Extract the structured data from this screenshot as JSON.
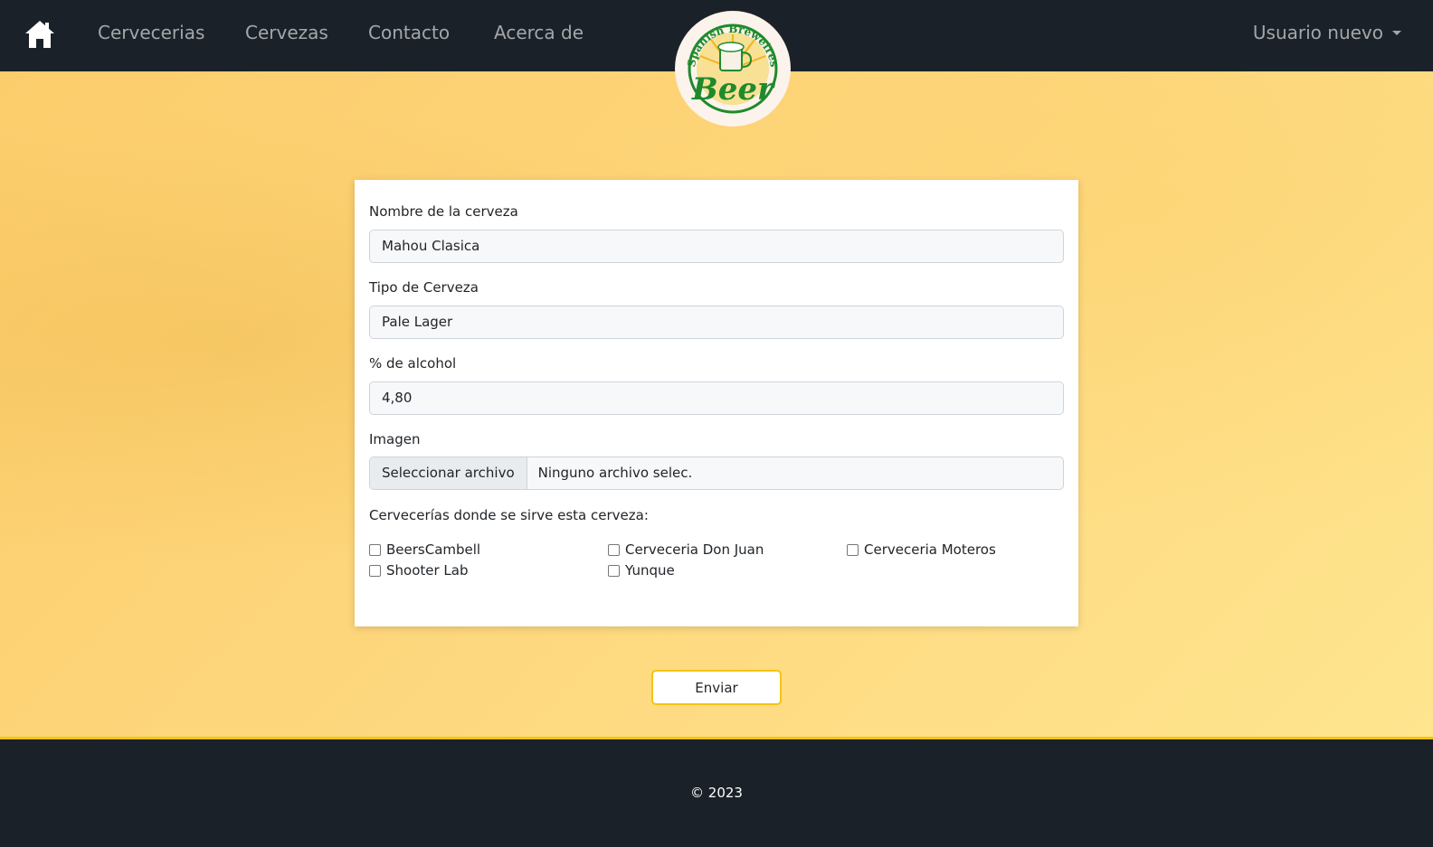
{
  "navbar": {
    "links": [
      "Cervecerias",
      "Cervezas",
      "Contacto",
      "Acerca de"
    ],
    "user_menu": "Usuario nuevo",
    "icons": {
      "home": "home-icon",
      "caret": "caret-down-icon"
    }
  },
  "logo": {
    "arc_text": "Spanish Breweires",
    "main_text": "Beer",
    "colors": {
      "green": "#1f8a2c",
      "gold": "#f2b41c",
      "bg": "#fbf3ec"
    }
  },
  "form": {
    "name_label": "Nombre de la cerveza",
    "name_value": "Mahou Clasica",
    "type_label": "Tipo de Cerveza",
    "type_value": "Pale Lager",
    "alcohol_label": "% de alcohol",
    "alcohol_value": "4,80",
    "image_label": "Imagen",
    "file_button": "Seleccionar archivo",
    "file_status": "Ninguno archivo selec.",
    "breweries_label": "Cervecerías donde se sirve esta cerveza:",
    "breweries": [
      "BeersCambell",
      "Cerveceria Don Juan",
      "Cerveceria Moteros",
      "Shooter Lab",
      "Yunque"
    ]
  },
  "submit_label": "Enviar",
  "footer": {
    "copyright": "© 2023"
  },
  "colors": {
    "nav_bg": "#1b2128",
    "accent": "#f6c413",
    "hero": "#fdd57a"
  }
}
